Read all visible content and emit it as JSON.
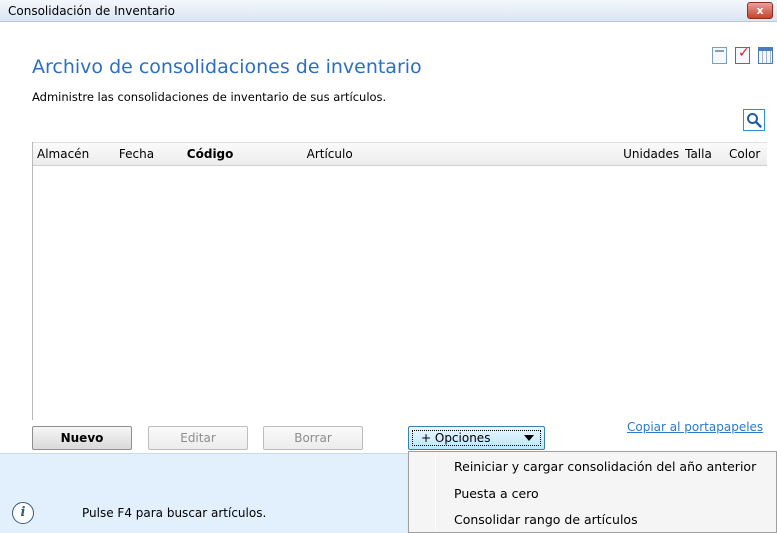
{
  "window": {
    "title": "Consolidación de Inventario",
    "close_glyph": "x"
  },
  "header": {
    "title": "Archivo de consolidaciones de inventario",
    "subtitle": "Administre las consolidaciones de inventario de sus artículos.",
    "icons": [
      "document-icon",
      "checklist-icon",
      "calendar-grid-icon"
    ]
  },
  "table": {
    "columns": [
      "Almacén",
      "Fecha",
      "Código",
      "Artículo",
      "Unidades",
      "Talla",
      "Color"
    ],
    "bold_column": "Código",
    "rows": []
  },
  "buttons": {
    "nuevo": "Nuevo",
    "editar": "Editar",
    "borrar": "Borrar",
    "opciones": "+ Opciones"
  },
  "copy_link": "Copiar al portapapeles",
  "options_menu": {
    "items": [
      "Reiniciar y cargar consolidación del año anterior",
      "Puesta a cero",
      "Consolidar rango de artículos"
    ]
  },
  "info": {
    "text": "Pulse F4 para buscar artículos."
  },
  "colors": {
    "title_blue": "#2b6fc4",
    "link_blue": "#2b7ac8",
    "info_bar": "#e2f0fd"
  }
}
